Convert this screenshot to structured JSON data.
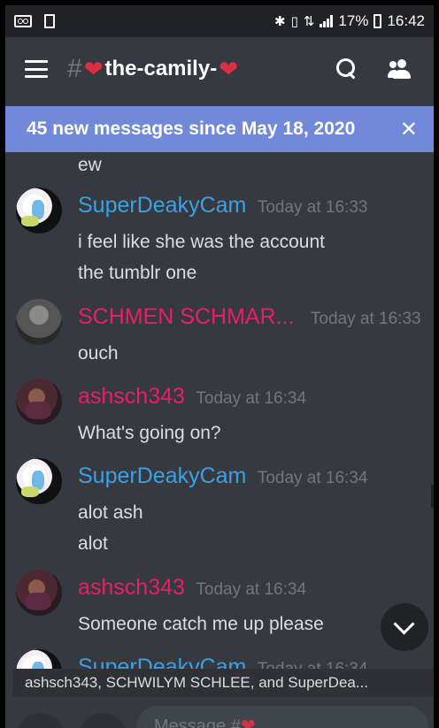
{
  "status_bar": {
    "battery": "17%",
    "time": "16:42"
  },
  "channel": {
    "hash": "#",
    "heart": "❤",
    "name": "the-camily-"
  },
  "banner": {
    "text": "45 new messages since May 18, 2020",
    "close": "✕"
  },
  "messages": {
    "continuation": "ew",
    "groups": [
      {
        "author": "SuperDeakyCam",
        "timestamp": "Today at 16:33",
        "lines": [
          "i feel like she was the account",
          "the tumblr one"
        ]
      },
      {
        "author": "SCHMEN SCHMAR...",
        "timestamp": "Today at 16:33",
        "lines": [
          "ouch"
        ]
      },
      {
        "author": "ashsch343",
        "timestamp": "Today at 16:34",
        "lines": [
          "What's going on?"
        ]
      },
      {
        "author": "SuperDeakyCam",
        "timestamp": "Today at 16:34",
        "lines": [
          "alot ash",
          "alot"
        ]
      },
      {
        "author": "ashsch343",
        "timestamp": "Today at 16:34",
        "lines": [
          "Someone catch me up please"
        ]
      },
      {
        "author": "SuperDeakyCam",
        "timestamp": "Today at 16:34",
        "lines": []
      }
    ]
  },
  "typing": {
    "text": "ashsch343, SCHWILYM SCHLEE, and SuperDea..."
  },
  "composer": {
    "placeholder": "Message #",
    "heart": "❤"
  },
  "colors": {
    "background": "#36393f",
    "banner": "#7289da",
    "name_blue": "#3ba1e3",
    "name_pink": "#e91e63"
  }
}
